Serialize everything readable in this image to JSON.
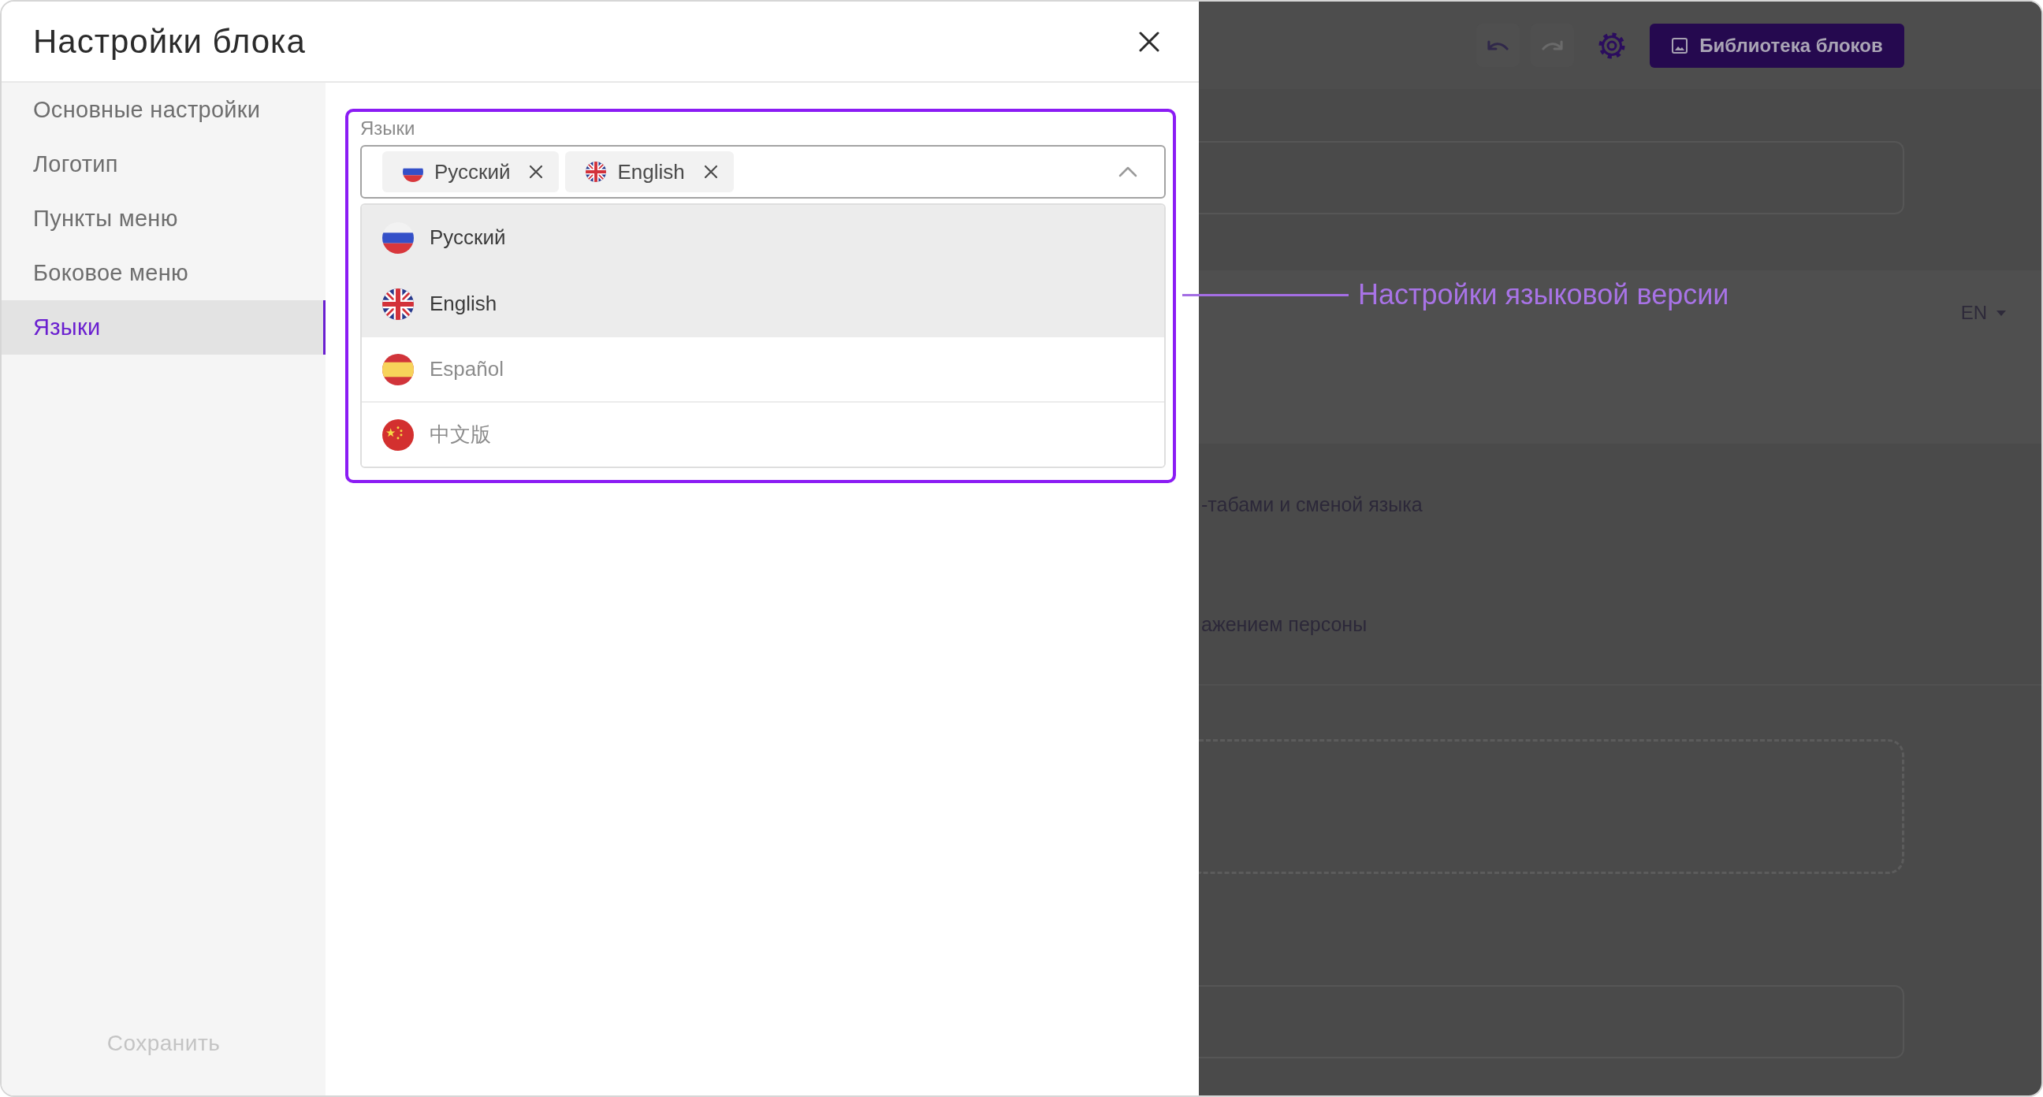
{
  "modal": {
    "title": "Настройки блока"
  },
  "sidebar": {
    "items": [
      {
        "label": "Основные настройки",
        "selected": false
      },
      {
        "label": "Логотип",
        "selected": false
      },
      {
        "label": "Пункты меню",
        "selected": false
      },
      {
        "label": "Боковое меню",
        "selected": false
      },
      {
        "label": "Языки",
        "selected": true
      }
    ],
    "save_button": {
      "label": "Сохранить",
      "disabled": true
    }
  },
  "languages_field": {
    "label": "Языки",
    "chips": [
      {
        "label": "Русский",
        "kind": "ru"
      },
      {
        "label": "English",
        "kind": "uk"
      }
    ],
    "expanded": true,
    "options": [
      {
        "label": "Русский",
        "kind": "ru",
        "selected": true
      },
      {
        "label": "English",
        "kind": "uk",
        "selected": true
      },
      {
        "label": "Español",
        "kind": "es",
        "selected": false
      },
      {
        "label": "中文版",
        "kind": "cn",
        "selected": false
      }
    ]
  },
  "annotation": {
    "text": "Настройки языковой версии"
  },
  "background_page": {
    "undo_button": {
      "disabled": false
    },
    "redo_button": {
      "disabled": true
    },
    "library_button": {
      "label": "Библиотека блоков"
    },
    "language_switch": {
      "value": "EN",
      "expanded": false
    },
    "texts": [
      "-табами и сменой языка",
      "ажением персоны"
    ]
  }
}
